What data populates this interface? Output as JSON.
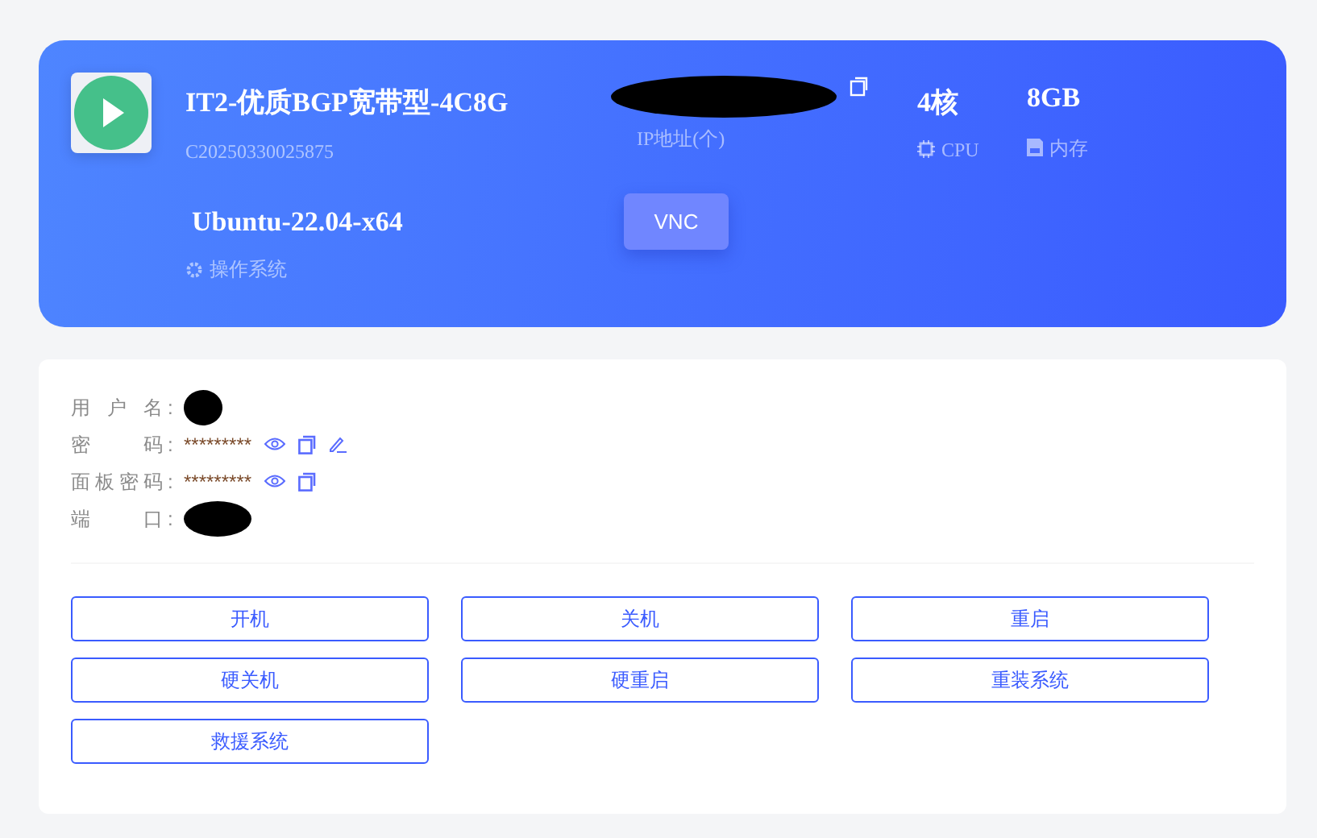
{
  "server": {
    "name": "IT2-优质BGP宽带型-4C8G",
    "id": "C20250330025875",
    "os": "Ubuntu-22.04-x64",
    "os_label": "操作系统",
    "ip_label": "IP地址(个)",
    "cpu": "4核",
    "cpu_label": "CPU",
    "memory": "8GB",
    "memory_label": "内存",
    "vnc_button": "VNC"
  },
  "credentials": [
    {
      "label": "用户名",
      "colon": ":",
      "kind": "redacted"
    },
    {
      "label": "密码",
      "colon": ":",
      "kind": "secret",
      "value": "*********",
      "editable": true
    },
    {
      "label": "面板密码",
      "colon": ":",
      "kind": "secret",
      "value": "*********",
      "editable": false
    },
    {
      "label": "端口",
      "colon": ":",
      "kind": "redacted"
    }
  ],
  "actions": [
    "开机",
    "关机",
    "重启",
    "硬关机",
    "硬重启",
    "重装系统",
    "救援系统"
  ]
}
